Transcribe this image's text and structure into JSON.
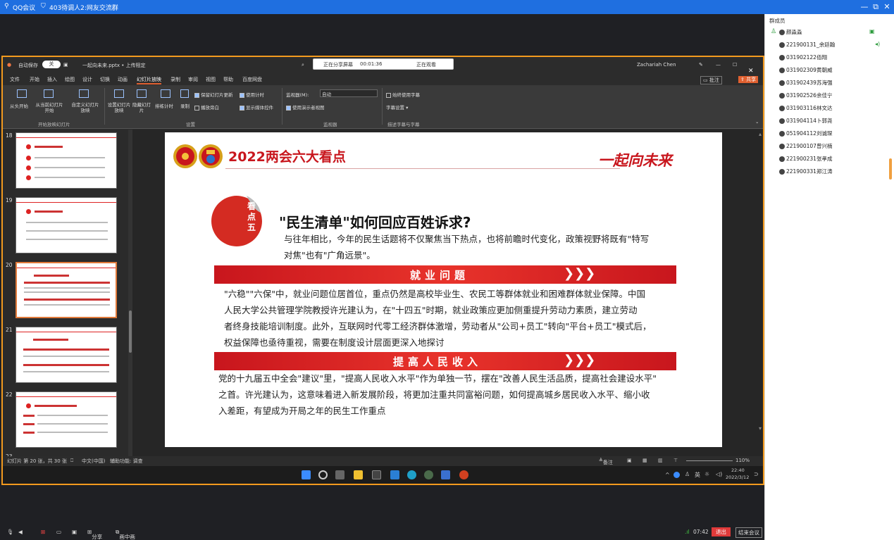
{
  "window": {
    "app": "QQ会议",
    "group_title": "403待调人2:网友交流群",
    "controls": [
      "—",
      "⧉",
      "✕"
    ]
  },
  "ppt": {
    "autosave": "自动保存",
    "toggle": "关",
    "filename": "一起向未来.pptx • 上传阻定",
    "user": "Zachariah Chen",
    "share_label": "正在分享屏幕",
    "share_timer": "00:01:36",
    "share_status": "正在观看",
    "menu": [
      "文件",
      "开始",
      "插入",
      "绘图",
      "设计",
      "切换",
      "动画",
      "幻灯片放映",
      "录制",
      "审阅",
      "视图",
      "帮助",
      "百度网盘"
    ],
    "ribbon": {
      "from_start": "从头开始",
      "from_current": "从当前幻灯片开始",
      "custom": "自定义幻灯片放映",
      "setup": "设置幻灯片放映",
      "hide": "隐藏幻灯片",
      "rehearse": "排练计时",
      "record": "录制",
      "play_narration": "播放旁白",
      "use_timing": "使用计时",
      "show_media": "显示媒体控件",
      "keep_slides": "保留幻灯片更新",
      "monitor_label": "监视器(M):",
      "monitor_value": "自动",
      "presenter_view": "使用演示者视图",
      "subtitles": "始终使用字幕",
      "subtitle_settings": "字幕设置",
      "group_start": "开始放映幻灯片",
      "group_setup": "设置",
      "group_monitor": "监视器",
      "group_captions": "描述字幕与字幕"
    },
    "thumb_numbers": [
      "18",
      "19",
      "20",
      "21",
      "22",
      "23"
    ],
    "status": {
      "slide_info": "幻灯片 第 20 张，共 30 张",
      "lang": "中文(中国)",
      "accessibility": "辅助功能: 调查",
      "notes": "备注",
      "zoom": "110%"
    },
    "tray": {
      "ime": "英",
      "time": "22:40",
      "date": "2022/3/12"
    }
  },
  "slide": {
    "header_title": "2022两会六大看点",
    "slogan": "一起向未来",
    "badge": [
      "看",
      "点",
      "五"
    ],
    "question": "\"民生清单\"如何回应百姓诉求?",
    "intro_1": "与往年相比，今年的民生话题将不仅聚焦当下热点，也将前瞻时代变化，政策视野将既有\"特写",
    "intro_2": "对焦\"也有\"广角远景\"。",
    "section1": "就业问题",
    "section1_body": [
      "\"六稳\"\"六保\"中，就业问题位居首位，重点仍然是高校毕业生、农民工等群体就业和困难群体就业保障。中国",
      "人民大学公共管理学院教授许光建认为，在\"十四五\"时期，就业政策应更加侧重提升劳动力素质，建立劳动",
      "者终身技能培训制度。此外，互联网时代零工经济群体激增，劳动者从\"公司+员工\"转向\"平台+员工\"模式后，",
      "权益保障也亟待重视，需要在制度设计层面更深入地探讨"
    ],
    "section2": "提高人民收入",
    "section2_body": [
      "党的十九届五中全会\"建议\"里，\"提高人民收入水平\"作为单独一节，摆在\"改善人民生活品质，提高社会建设水平\"",
      "之首。许光建认为，这意味着进入新发展阶段，将更加注重共同富裕问题，如何提高城乡居民收入水平、缩小收",
      "入差距，有望成为开局之年的民生工作重点"
    ],
    "chevrons": "❯❯❯"
  },
  "panel": {
    "title": "群成员",
    "members": [
      "颜淼淼",
      "221900131_余廷翰",
      "031902122佰翔",
      "031902309黄朝威",
      "031902439苏海强",
      "031902526余佳宁",
      "031903116林文达",
      "031904114卜郭尧",
      "051904112刘诚琛",
      "221900107曾兴楠",
      "221900231张孝成",
      "221900331郑江涛"
    ]
  },
  "bottom": {
    "mute": "",
    "share": "分享",
    "gallery": "画中画",
    "network": "07:42",
    "leave": "退出",
    "end_meeting": "结束会议"
  },
  "colors": {
    "accent": "#1f6fe0",
    "ppt_red": "#c8161d",
    "share_border": "#f39a1e"
  }
}
